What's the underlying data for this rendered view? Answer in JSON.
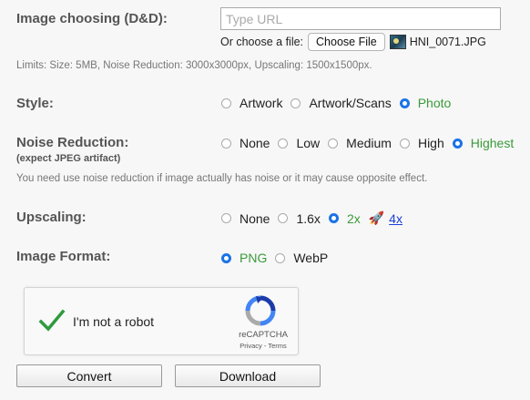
{
  "image": {
    "label": "Image choosing (D&D):",
    "url_placeholder": "Type URL",
    "url_value": "",
    "file_prefix": "Or choose a file:",
    "file_button": "Choose File",
    "file_name": "HNI_0071.JPG",
    "limits": "Limits: Size: 5MB, Noise Reduction: 3000x3000px, Upscaling: 1500x1500px."
  },
  "style": {
    "label": "Style:",
    "options": [
      {
        "label": "Artwork",
        "selected": false
      },
      {
        "label": "Artwork/Scans",
        "selected": false
      },
      {
        "label": "Photo",
        "selected": true
      }
    ]
  },
  "noise": {
    "label": "Noise Reduction:",
    "sublabel": "(expect JPEG artifact)",
    "options": [
      {
        "label": "None",
        "selected": false
      },
      {
        "label": "Low",
        "selected": false
      },
      {
        "label": "Medium",
        "selected": false
      },
      {
        "label": "High",
        "selected": false
      },
      {
        "label": "Highest",
        "selected": true
      }
    ],
    "note": "You need use noise reduction if image actually has noise or it may cause opposite effect."
  },
  "upscaling": {
    "label": "Upscaling:",
    "options": [
      {
        "label": "None",
        "selected": false
      },
      {
        "label": "1.6x",
        "selected": false
      },
      {
        "label": "2x",
        "selected": true
      }
    ],
    "link_4x": "4x"
  },
  "format": {
    "label": "Image Format:",
    "options": [
      {
        "label": "PNG",
        "selected": true
      },
      {
        "label": "WebP",
        "selected": false
      }
    ]
  },
  "captcha": {
    "text": "I'm not a robot",
    "brand": "reCAPTCHA",
    "links": "Privacy - Terms"
  },
  "buttons": {
    "convert": "Convert",
    "download": "Download"
  },
  "colors": {
    "selected_text": "#3a9a3a",
    "radio_on": "#1a73e8",
    "link": "#1a3ed6"
  },
  "icons": {
    "file_thumbnail": "image-thumbnail-icon",
    "rocket": "rocket-icon",
    "checkmark": "checkmark-icon",
    "recaptcha": "recaptcha-logo-icon"
  }
}
